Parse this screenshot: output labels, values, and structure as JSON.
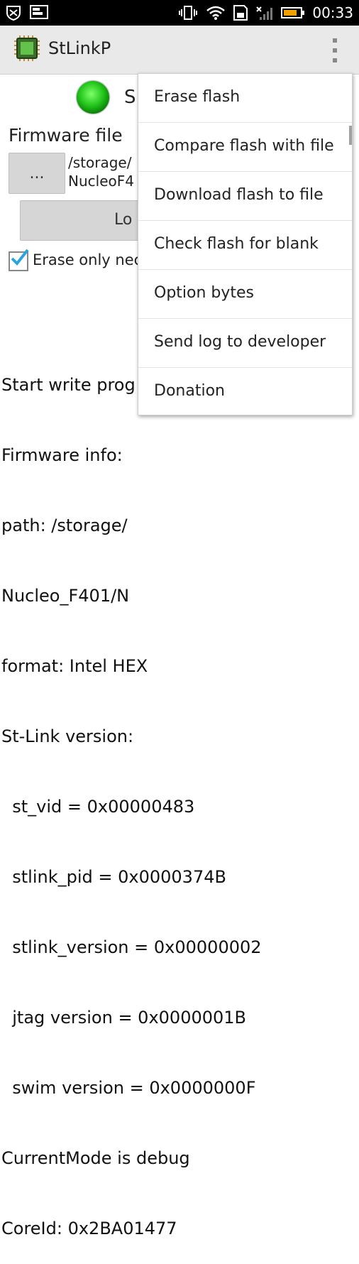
{
  "status_bar": {
    "time": "00:33",
    "left_icons": [
      "shield-icon",
      "image-icon"
    ],
    "right_icons": [
      "vibrate-icon",
      "wifi-icon",
      "sd-card-icon",
      "signal-icon",
      "battery-icon"
    ]
  },
  "action_bar": {
    "title": "StLinkP"
  },
  "main": {
    "status_text": "S",
    "firmware_label": "Firmware file",
    "browse_label": "...",
    "path_text": "/storage/\nNucleoF4",
    "load_label": "Lo",
    "erase_checkbox_label": "Erase only nec",
    "erase_checked": true
  },
  "log_lines": [
    "Start write prog",
    "Firmware info:",
    "path: /storage/",
    "Nucleo_F401/N",
    "format: Intel HEX",
    "St-Link version:",
    "  st_vid = 0x00000483",
    "  stlink_pid = 0x0000374B",
    "  stlink_version = 0x00000002",
    "  jtag version = 0x0000001B",
    "  swim version = 0x0000000F",
    "CurrentMode is debug",
    "CoreId: 0x2BA01477"
  ],
  "menu": {
    "items": [
      "Erase flash",
      "Compare flash with file",
      "Download flash to file",
      "Check flash for blank",
      "Option bytes",
      "Send log to developer",
      "Donation"
    ]
  },
  "colors": {
    "status_bar_bg": "#000000",
    "action_bar_bg": "#e9e9e9",
    "led_green": "#22c41a",
    "checkbox_check": "#2aa4e0"
  }
}
